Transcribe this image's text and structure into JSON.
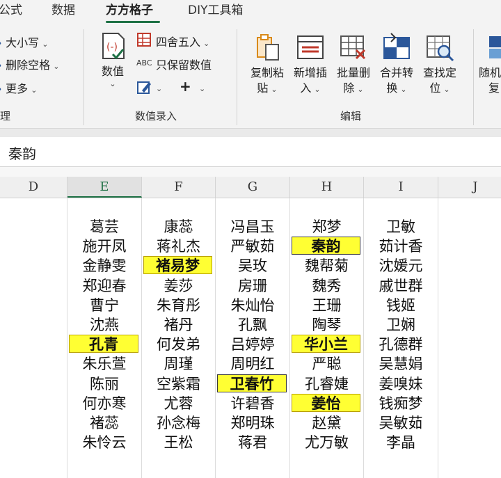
{
  "tabs": [
    {
      "label": "公式"
    },
    {
      "label": "数据"
    },
    {
      "label": "方方格子"
    },
    {
      "label": "DIY工具箱"
    }
  ],
  "ribbon": {
    "case_label": "大小写",
    "delete_space_label": "删除空格",
    "more_label": "更多",
    "group_text_label": "理",
    "numeric_label": "数值",
    "round_label": "四舍五入",
    "keep_value_label": "只保留数值",
    "abc_glyph": "ABC",
    "plus_glyph": "+",
    "group_numeric_label": "数值录入",
    "copy_paste": [
      "复制粘",
      "贴"
    ],
    "insert_new": [
      "新增插",
      "入"
    ],
    "batch_delete": [
      "批量删",
      "除"
    ],
    "merge_convert": [
      "合并转",
      "换"
    ],
    "find_locate": [
      "查找定",
      "位"
    ],
    "random": [
      "随机",
      "复"
    ],
    "group_edit_label": "编辑"
  },
  "formula_bar": {
    "value": "秦韵"
  },
  "columns": [
    "D",
    "E",
    "F",
    "G",
    "H",
    "I",
    "J"
  ],
  "selected_column": "E",
  "rows": [
    [
      "葛芸",
      "康蕊",
      "冯昌玉",
      "郑梦",
      "卫敏"
    ],
    [
      "施开凤",
      "蒋礼杰",
      "严敏茹",
      "秦韵",
      "茹计香"
    ],
    [
      "金静雯",
      "褚易梦",
      "吴玫",
      "魏帮菊",
      "沈媛元"
    ],
    [
      "郑迎春",
      "姜莎",
      "房珊",
      "魏秀",
      "戚世群"
    ],
    [
      "曹宁",
      "朱育彤",
      "朱灿怡",
      "王珊",
      "钱姬"
    ],
    [
      "沈燕",
      "褚丹",
      "孔飘",
      "陶琴",
      "卫娴"
    ],
    [
      "孔青",
      "何发弟",
      "吕婷婷",
      "华小兰",
      "孔德群"
    ],
    [
      "朱乐萱",
      "周瑾",
      "周明红",
      "严聪",
      "吴慧娟"
    ],
    [
      "陈丽",
      "空紫霜",
      "卫春竹",
      "孔睿婕",
      "姜嗅妹"
    ],
    [
      "何亦寒",
      "尤蓉",
      "许碧香",
      "姜怡",
      "钱痴梦"
    ],
    [
      "褚蕊",
      "孙念梅",
      "郑明珠",
      "赵黛",
      "吴敏茹"
    ],
    [
      "朱怜云",
      "王松",
      "蒋君",
      "尤万敏",
      "李晶"
    ]
  ],
  "highlight_color": "#ffff33",
  "accent_color": "#1e7145"
}
